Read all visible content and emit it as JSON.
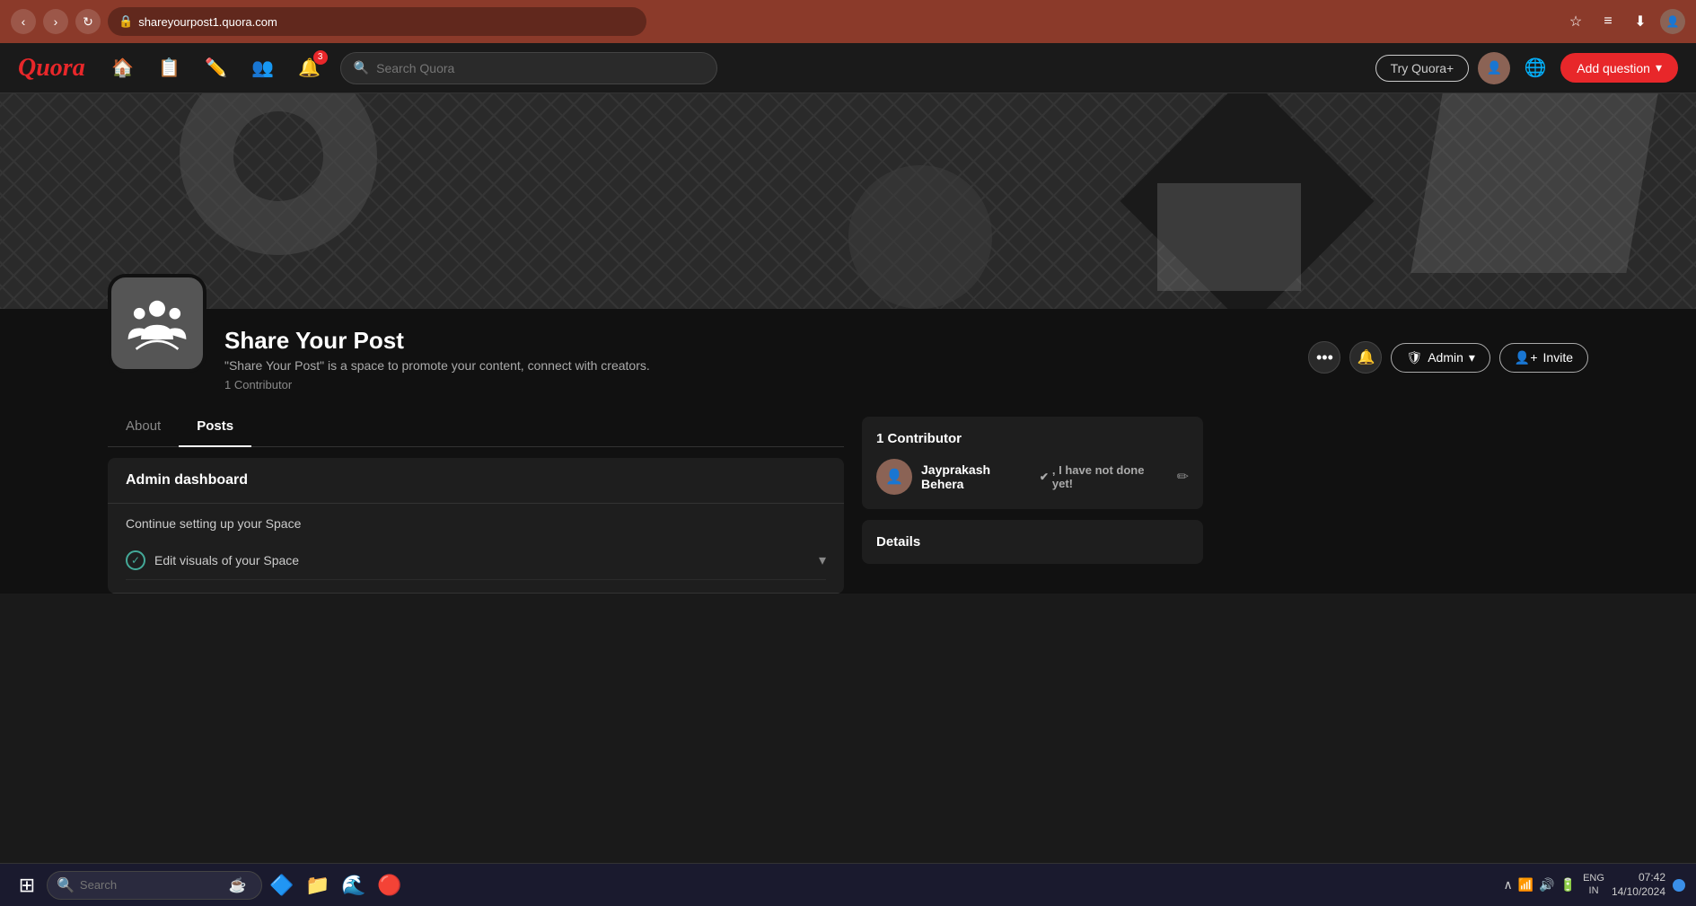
{
  "browser": {
    "url": "shareyourpost1.quora.com",
    "back_btn": "‹",
    "forward_btn": "›",
    "refresh_btn": "↻"
  },
  "nav": {
    "logo": "Quora",
    "search_placeholder": "Search Quora",
    "try_quora_label": "Try Quora+",
    "add_question_label": "Add question",
    "notification_count": "3"
  },
  "space": {
    "name": "Share Your Post",
    "description": "\"Share Your Post\" is a space to promote your content, connect with creators.",
    "contributors_count": "1 Contributor",
    "more_label": "•••",
    "admin_label": "Admin",
    "invite_label": "Invite"
  },
  "tabs": {
    "about": "About",
    "posts": "Posts",
    "active": "posts"
  },
  "admin_dashboard": {
    "title": "Admin dashboard",
    "setup_title": "Continue setting up your Space",
    "items": [
      {
        "label": "Edit visuals of your Space",
        "done": true
      }
    ]
  },
  "contributors_panel": {
    "title": "1 Contributor",
    "contributor": {
      "name": "Jayprakash Behera",
      "bio": ", I have not done yet!"
    }
  },
  "details_panel": {
    "title": "Details"
  },
  "taskbar": {
    "search_placeholder": "Search",
    "time": "07:42",
    "date": "14/10/2024",
    "lang": "ENG",
    "region": "IN"
  }
}
